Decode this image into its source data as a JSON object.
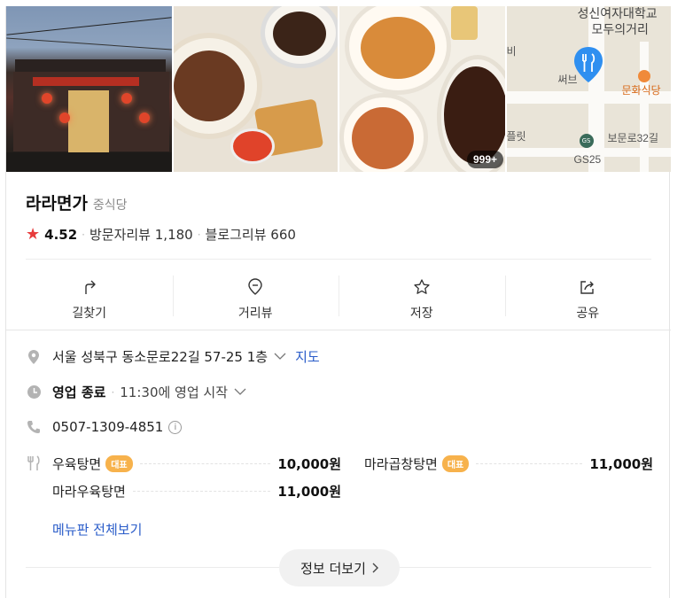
{
  "photos": {
    "more_count": "999+"
  },
  "map": {
    "labels": [
      "성신여자대학교",
      "모두의거리",
      "비",
      "써브",
      "문화식당",
      "플릿",
      "보문로32길",
      "GS25"
    ],
    "gs_badge": "GS 25"
  },
  "place": {
    "name": "라라면가",
    "category": "중식당",
    "rating": "4.52",
    "visitor_reviews": "방문자리뷰 1,180",
    "blog_reviews": "블로그리뷰 660"
  },
  "actions": [
    {
      "label": "길찾기",
      "icon": "directions-icon"
    },
    {
      "label": "거리뷰",
      "icon": "street-view-icon"
    },
    {
      "label": "저장",
      "icon": "star-outline-icon"
    },
    {
      "label": "공유",
      "icon": "share-icon"
    }
  ],
  "details": {
    "address": "서울 성북구 동소문로22길 57-25 1층",
    "map_link": "지도",
    "status": "영업 종료",
    "hours": "11:30에 영업 시작",
    "phone": "0507-1309-4851"
  },
  "menu": {
    "rep_badge": "대표",
    "items": [
      {
        "name": "우육탕면",
        "price": "10,000원",
        "representative": true
      },
      {
        "name": "마라곱창탕면",
        "price": "11,000원",
        "representative": true
      },
      {
        "name": "마라우육탕면",
        "price": "11,000원",
        "representative": false
      }
    ],
    "see_all": "메뉴판 전체보기"
  },
  "more_button": "정보 더보기",
  "colors": {
    "star": "#e73c3c",
    "link": "#2a5cc9",
    "badge": "#f7b24c",
    "pin": "#2f8ff0"
  }
}
